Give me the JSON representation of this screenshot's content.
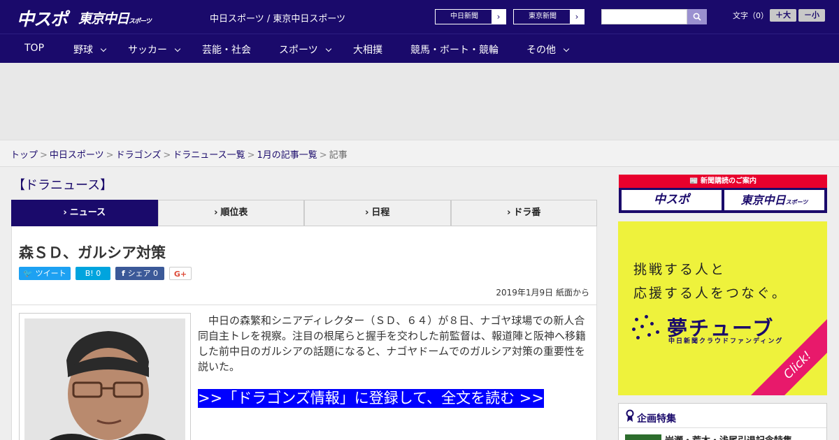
{
  "header": {
    "logo_chuspo": "中スポ",
    "logo_tokyo": "東京中日",
    "logo_tokyo_sub": "スポーツ",
    "site_names": "中日スポーツ / 東京中日スポーツ",
    "links": [
      {
        "label": "中日新聞"
      },
      {
        "label": "東京新聞"
      }
    ],
    "search_placeholder": "",
    "fontsize_label": "文字（0）",
    "fontsize_up": "＋大",
    "fontsize_down": "－小"
  },
  "nav": {
    "items": [
      {
        "label": "TOP",
        "has_menu": false
      },
      {
        "label": "野球",
        "has_menu": true
      },
      {
        "label": "サッカー",
        "has_menu": true
      },
      {
        "label": "芸能・社会",
        "has_menu": false
      },
      {
        "label": "スポーツ",
        "has_menu": true
      },
      {
        "label": "大相撲",
        "has_menu": false
      },
      {
        "label": "競馬・ボート・競輪",
        "has_menu": false
      },
      {
        "label": "その他",
        "has_menu": true
      }
    ]
  },
  "breadcrumb": {
    "items": [
      "トップ",
      "中日スポーツ",
      "ドラゴンズ",
      "ドラニュース一覧",
      "1月の記事一覧"
    ],
    "current": "記事",
    "separator": ">"
  },
  "main": {
    "section_title": "【ドラニュース】",
    "tabs": [
      {
        "label": "ニュース",
        "active": true
      },
      {
        "label": "順位表",
        "active": false
      },
      {
        "label": "日程",
        "active": false
      },
      {
        "label": "ドラ番",
        "active": false
      }
    ],
    "article": {
      "headline": "森ＳＤ、ガルシア対策",
      "share": {
        "tweet": "ツイート",
        "hatena": "B! 0",
        "facebook": "シェア 0",
        "google": "G+"
      },
      "dateline": "2019年1月9日 紙面から",
      "body": "中日の森繁和シニアディレクター（ＳＤ、６４）が８日、ナゴヤ球場での新人合同自主トレを視察。注目の根尾らと握手を交わした前監督は、報道陣と阪神へ移籍した前中日のガルシアの話題になると、ナゴヤドームでのガルシア対策の重要性を説いた。",
      "cta": ">>「ドラゴンズ情報」に登録して、全文を読む >>"
    }
  },
  "sidebar": {
    "subscribe_head": "新聞購読のご案内",
    "subscribe_logo_1": "中スポ",
    "subscribe_logo_2": "東京中日",
    "subscribe_logo_2_sub": "スポーツ",
    "banner_line1": "挑戦する人と",
    "banner_line2": "応援する人をつなぐ。",
    "banner_brand": "夢チューブ",
    "banner_sub": "中日新聞クラウドファンディング",
    "banner_click": "Click!",
    "feature_title": "企画特集",
    "feature_item": "岩瀬・荒木・浅尾引退記念特集"
  },
  "colors": {
    "brand_navy": "#1a0a6b",
    "cta_blue": "#0000ff",
    "banner_yellow": "#eef23c",
    "accent_red": "#e8002d"
  }
}
